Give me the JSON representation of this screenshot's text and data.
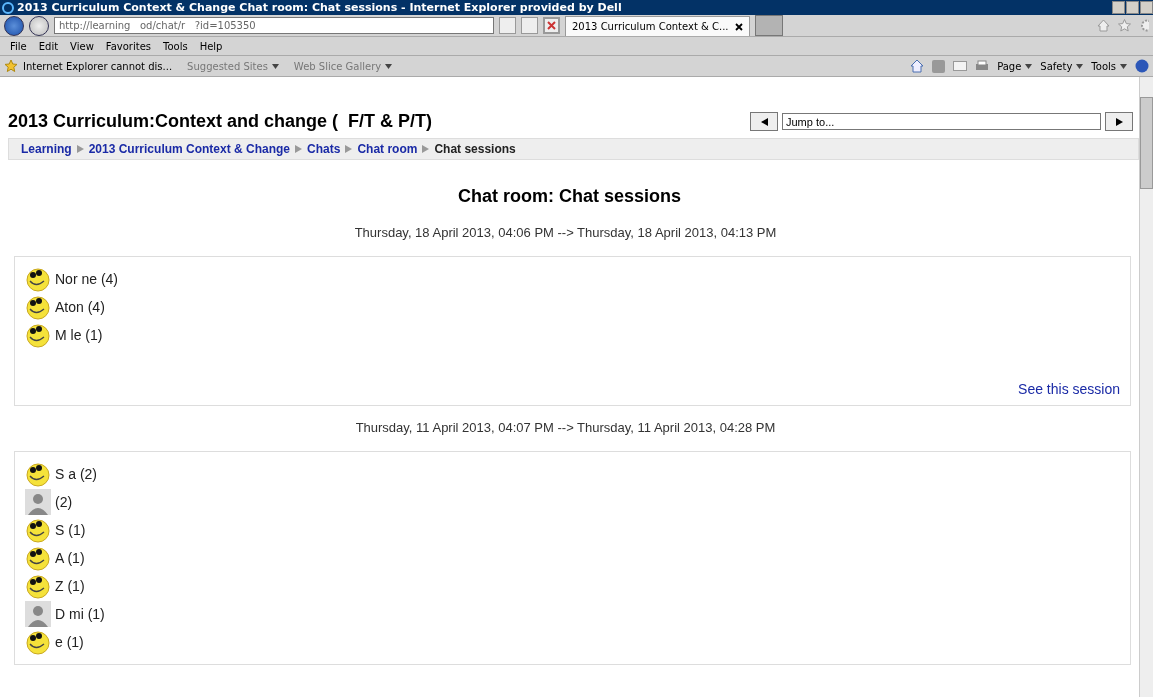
{
  "window": {
    "title": "2013 Curriculum Context & Change Chat room: Chat sessions - Internet Explorer provided by Dell"
  },
  "address_bar": {
    "value": "http://learning   od/chat/r   ?id=105350"
  },
  "tabs": [
    {
      "label": "2013 Curriculum Context & C...",
      "selected": true
    }
  ],
  "menu": [
    "File",
    "Edit",
    "View",
    "Favorites",
    "Tools",
    "Help"
  ],
  "favorites": [
    {
      "label": "Internet Explorer cannot dis...",
      "kind": "link"
    },
    {
      "label": "Suggested Sites",
      "kind": "menu"
    },
    {
      "label": "Web Slice Gallery",
      "kind": "menu"
    }
  ],
  "command_bar": [
    "Page",
    "Safety",
    "Tools"
  ],
  "course_title": "2013 Curriculum:Context and change (  F/T & P/T)",
  "jump_to": {
    "value": "Jump to..."
  },
  "breadcrumb": [
    {
      "label": "Learning",
      "link": true
    },
    {
      "label": "2013 Curriculum Context & Change",
      "link": true
    },
    {
      "label": "Chats",
      "link": true
    },
    {
      "label": "Chat room",
      "link": true
    },
    {
      "label": "Chat sessions",
      "link": false
    }
  ],
  "heading": "Chat room: Chat sessions",
  "sessions": [
    {
      "range": "Thursday, 18 April 2013, 04:06 PM --> Thursday, 18 April 2013, 04:13 PM",
      "link": "See this session",
      "users": [
        {
          "name": "Nor ne (4)",
          "kind": "smiley"
        },
        {
          "name": "Aton (4)",
          "kind": "smiley"
        },
        {
          "name": "M le (1)",
          "kind": "smiley"
        }
      ]
    },
    {
      "range": "Thursday, 11 April 2013, 04:07 PM --> Thursday, 11 April 2013, 04:28 PM",
      "users": [
        {
          "name": "S a (2)",
          "kind": "smiley"
        },
        {
          "name": "(2)",
          "kind": "photo"
        },
        {
          "name": "S (1)",
          "kind": "smiley"
        },
        {
          "name": "A (1)",
          "kind": "smiley"
        },
        {
          "name": "Z (1)",
          "kind": "smiley"
        },
        {
          "name": "D mi (1)",
          "kind": "photo"
        },
        {
          "name": "e (1)",
          "kind": "smiley"
        }
      ]
    }
  ]
}
